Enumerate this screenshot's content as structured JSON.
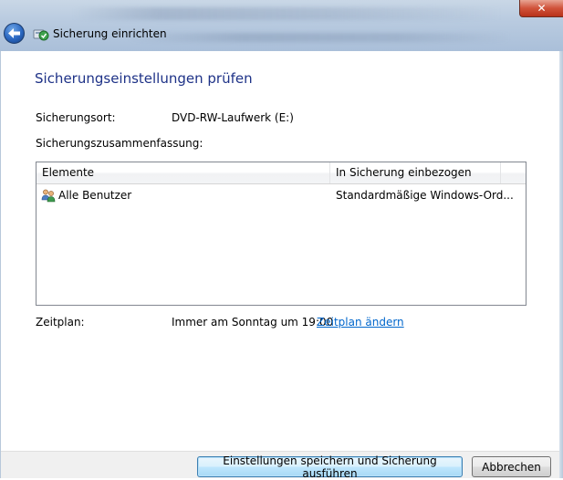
{
  "window": {
    "title": "Sicherung einrichten",
    "close_glyph": "✕"
  },
  "page": {
    "heading": "Sicherungseinstellungen prüfen",
    "location_label": "Sicherungsort:",
    "location_value": "DVD-RW-Laufwerk (E:)",
    "summary_label": "Sicherungszusammenfassung:",
    "schedule_label": "Zeitplan:",
    "schedule_value": "Immer am Sonntag um 19:00",
    "schedule_link": "Zeitplan ändern"
  },
  "list": {
    "columns": [
      "Elemente",
      "In Sicherung einbezogen"
    ],
    "rows": [
      {
        "item": "Alle Benutzer",
        "included": "Standardmäßige Windows-Ord...",
        "icon": "users-icon"
      }
    ]
  },
  "buttons": {
    "save_run": "Einstellungen speichern und Sicherung ausführen",
    "cancel": "Abbrechen"
  },
  "colors": {
    "heading": "#1e3287",
    "link": "#0066cc",
    "default_button_border": "#3c7fb1"
  }
}
